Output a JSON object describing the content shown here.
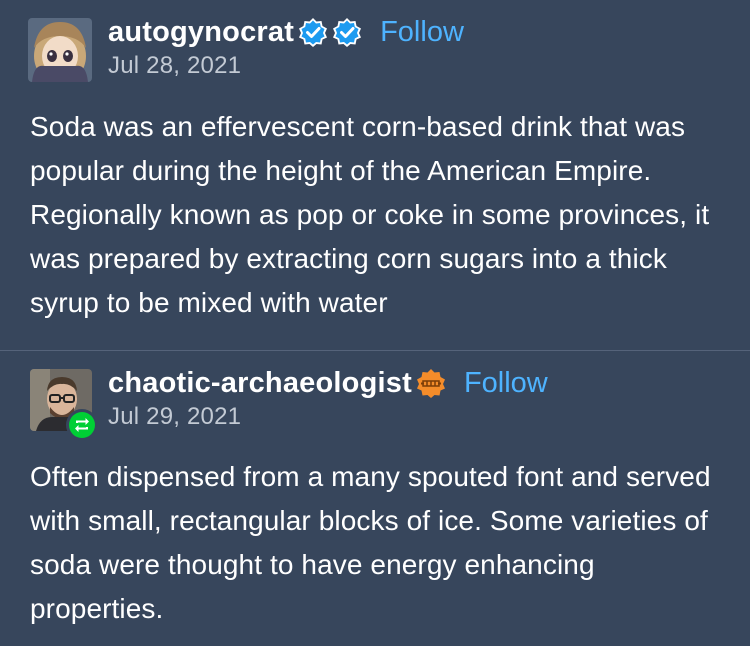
{
  "posts": [
    {
      "username": "autogynocrat",
      "date": "Jul 28, 2021",
      "follow_label": "Follow",
      "badges": [
        "verified-check-icon",
        "verified-check-icon"
      ],
      "text": "Soda was an effervescent corn-based drink that was popular during the height of the American Empire. Regionally known as pop or coke in some provinces, it was prepared by extracting corn sugars into a thick syrup to be mixed with water"
    },
    {
      "username": "chaotic-archaeologist",
      "date": "Jul 29, 2021",
      "follow_label": "Follow",
      "badges": [
        "orange-badge-icon"
      ],
      "reblog_icon": "reblog-icon",
      "text": "Often dispensed from a many spouted font and served with small, rectangular blocks of ice. Some varieties of soda were thought to have energy enhancing properties."
    }
  ],
  "colors": {
    "background": "#37465c",
    "link": "#4eb3ff",
    "verified": "#1d9bf0",
    "orange_badge": "#f48c2a",
    "reblog": "#00cf35"
  }
}
